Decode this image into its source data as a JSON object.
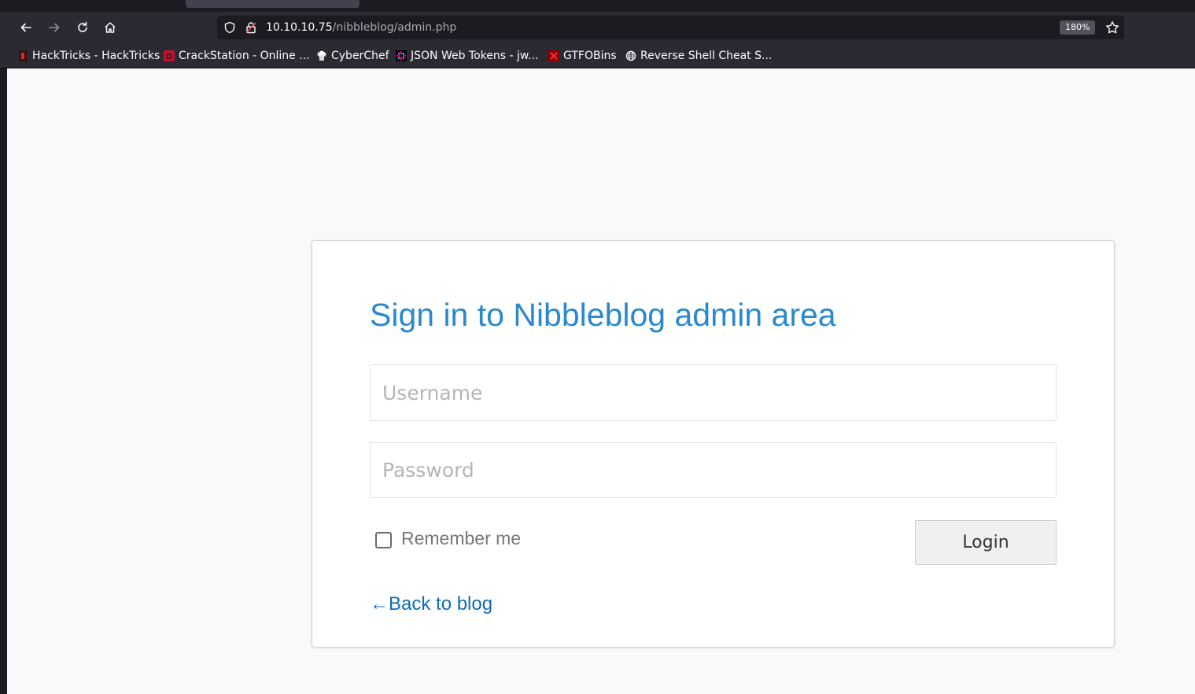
{
  "browser": {
    "url_host": "10.10.10.75",
    "url_path": "/nibbleblog/admin.php",
    "zoom": "180%",
    "bookmarks": [
      {
        "label": "HackTricks - HackTricks",
        "icon": "hacktricks-icon"
      },
      {
        "label": "CrackStation - Online ...",
        "icon": "crackstation-icon"
      },
      {
        "label": "CyberChef",
        "icon": "cyberchef-icon"
      },
      {
        "label": "JSON Web Tokens - jw...",
        "icon": "jwt-icon"
      },
      {
        "label": "GTFOBins",
        "icon": "gtfobins-icon"
      },
      {
        "label": "Reverse Shell Cheat S...",
        "icon": "globe-icon"
      }
    ]
  },
  "login": {
    "title": "Sign in to Nibbleblog admin area",
    "username_placeholder": "Username",
    "password_placeholder": "Password",
    "remember_label": "Remember me",
    "login_label": "Login",
    "back_label": "←Back to blog"
  },
  "colors": {
    "title": "#2a88cf",
    "link": "#0f6cb6",
    "page_bg": "#f9f9f9",
    "toolbar_bg": "#2b2a33"
  }
}
